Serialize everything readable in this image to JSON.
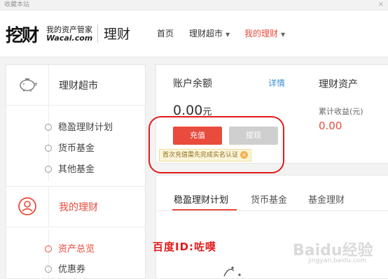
{
  "topbar": {
    "favorite": "收藏本站",
    "close_glyph": "×"
  },
  "header": {
    "logo_mark": "挖财",
    "logo_sub1": "我的资产管家",
    "logo_sub2": "Wacai.com",
    "section_title": "理财",
    "nav": [
      {
        "label": "首页"
      },
      {
        "label": "理财超市",
        "has_caret": true
      },
      {
        "label": "我的理财",
        "has_caret": true,
        "active": true
      }
    ]
  },
  "sidebar": {
    "market": {
      "title": "理财超市",
      "icon": "piggy-bank-icon",
      "items": [
        "稳盈理财计划",
        "货币基金",
        "其他基金"
      ]
    },
    "mine": {
      "title": "我的理财",
      "icon": "user-circle-icon",
      "items": [
        "资产总览",
        "优惠券"
      ],
      "active_index": 0
    }
  },
  "account": {
    "label": "账户余额",
    "detail_link": "详情",
    "balance": "0.00",
    "unit": "元",
    "charge_button": "充值",
    "withdraw_button": "提现",
    "tip": "首次充值需先完成实名认证"
  },
  "assets": {
    "label": "理财资产",
    "earnings_label": "累计收益(元)",
    "earnings_value": "0.00"
  },
  "tabs": [
    {
      "label": "稳盈理财计划",
      "active": true
    },
    {
      "label": "货币基金"
    },
    {
      "label": "基金理财"
    }
  ],
  "watermark": {
    "author": "百度ID:咗嗼",
    "baidu": "Baidu经验",
    "url": "jingyan.baidu.com"
  },
  "colors": {
    "accent": "#e94b3c",
    "link": "#3d8fd1",
    "annotation": "#e21b1b"
  }
}
